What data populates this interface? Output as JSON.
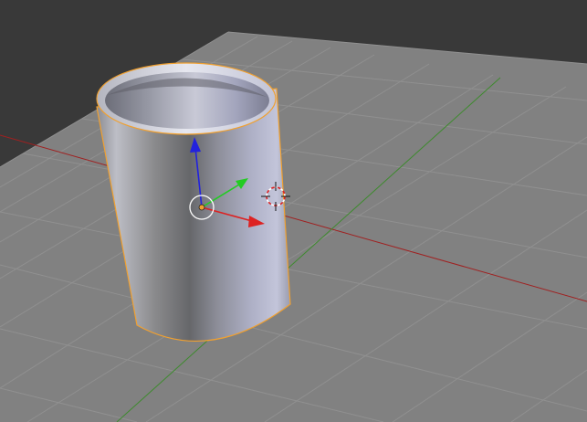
{
  "viewport": {
    "mode": "3d-viewport",
    "colors": {
      "background": "#393939",
      "floor": "#818181",
      "grid_line": "#909090",
      "x_axis": "#a02020",
      "y_axis": "#3e8a2e",
      "selection_outline": "#f0a030"
    }
  },
  "scene": {
    "object": {
      "name": "cup",
      "selected": true,
      "shading": "smooth"
    },
    "gizmo": {
      "type": "translate",
      "x_color": "#dd2222",
      "y_color": "#22cc22",
      "z_color": "#2222dd"
    },
    "cursor_3d": {
      "visible": true
    }
  }
}
